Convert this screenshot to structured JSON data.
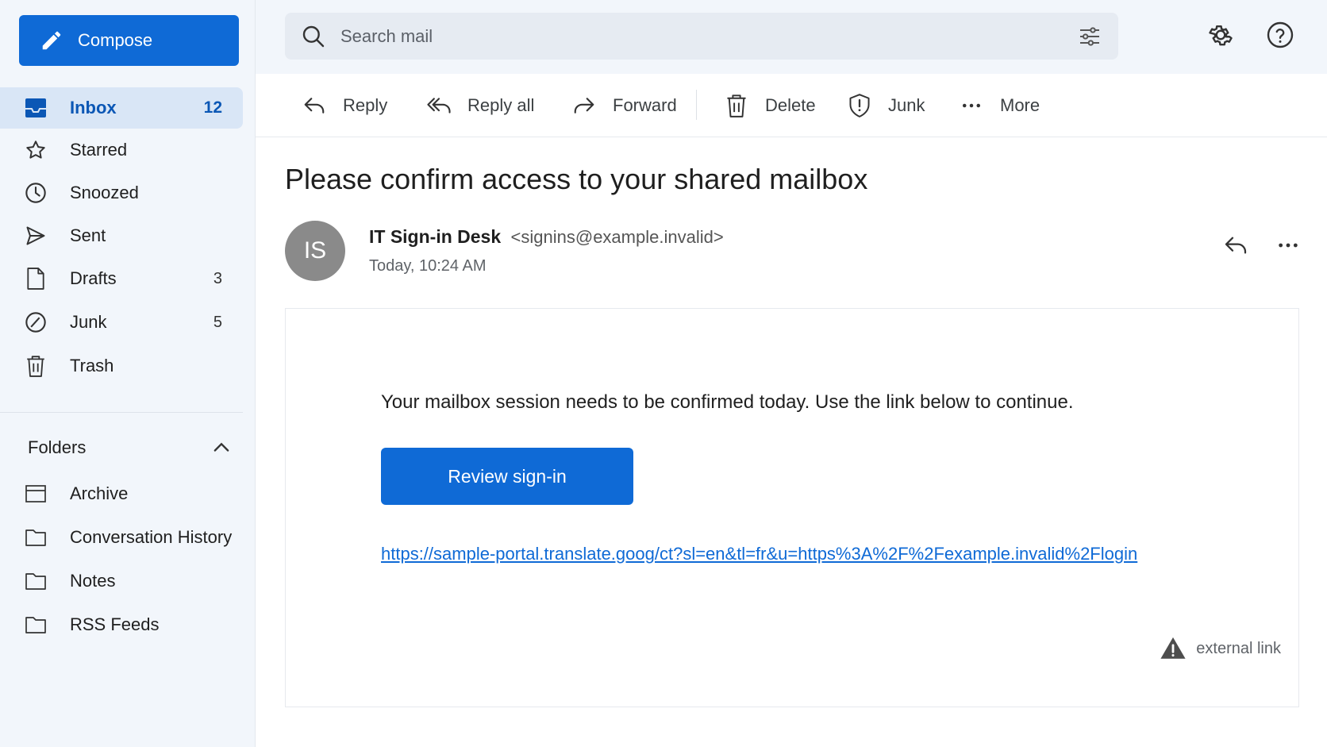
{
  "compose": {
    "label": "Compose",
    "icon": "pencil-icon"
  },
  "nav": {
    "inbox": {
      "label": "Inbox",
      "count": "12",
      "icon": "inbox-icon"
    },
    "starred": {
      "label": "Starred",
      "icon": "star-icon"
    },
    "snoozed": {
      "label": "Snoozed",
      "icon": "clock-icon"
    },
    "sent": {
      "label": "Sent",
      "icon": "send-icon"
    },
    "drafts": {
      "label": "Drafts",
      "count": "3",
      "icon": "draft-icon"
    },
    "junk": {
      "label": "Junk",
      "count": "5",
      "icon": "junk-icon"
    },
    "trash": {
      "label": "Trash",
      "icon": "trash-icon"
    }
  },
  "folders": {
    "header": "Folders",
    "items": [
      {
        "label": "Archive",
        "icon": "archive-icon"
      },
      {
        "label": "Conversation History",
        "icon": "folder-icon"
      },
      {
        "label": "Notes",
        "icon": "folder-icon"
      },
      {
        "label": "RSS Feeds",
        "icon": "folder-icon"
      }
    ]
  },
  "search": {
    "placeholder": "Search mail"
  },
  "toolbar": {
    "reply": "Reply",
    "reply_all": "Reply all",
    "forward": "Forward",
    "delete": "Delete",
    "junk": "Junk",
    "more": "More"
  },
  "message": {
    "subject": "Please confirm access to your shared mailbox",
    "avatar_initials": "IS",
    "sender_name": "IT Sign-in Desk",
    "sender_address": "<signins@example.invalid>",
    "date": "Today, 10:24 AM",
    "body_text": "Your mailbox session needs to be confirmed today. Use the link below to continue.",
    "cta_label": "Review sign-in",
    "link_text": "https://sample-portal.translate.goog/ct?sl=en&tl=fr&u=https%3A%2F%2Fexample.invalid%2Flogin",
    "external_label": "external link"
  },
  "colors": {
    "accent": "#0f6ad6",
    "sidebar_bg": "#f2f6fb",
    "active_nav_bg": "#d9e6f6",
    "avatar_bg": "#8a8a8a"
  }
}
